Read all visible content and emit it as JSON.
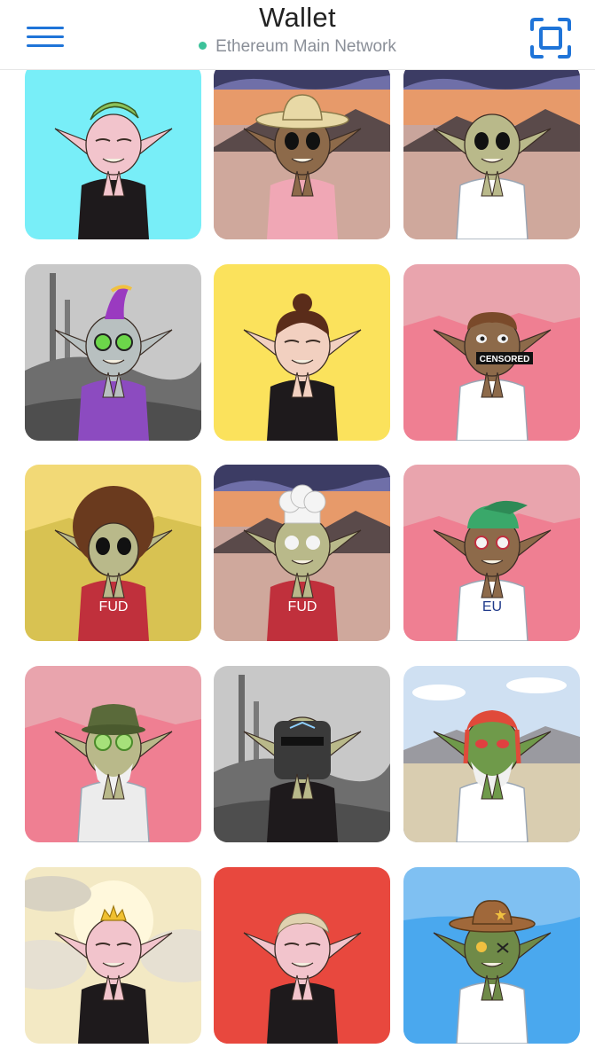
{
  "header": {
    "title": "Wallet",
    "network": "Ethereum Main Network",
    "network_dot_color": "#3cc29a",
    "accent": "#1f74d8",
    "menu_icon": "hamburger-menu-icon",
    "scan_icon": "qr-scan-icon"
  },
  "collectibles": [
    {
      "bg": "#78eef8",
      "scene": "plain",
      "skin": "#f2c4cc",
      "outfit": "#1e1a1c",
      "eyes": "sleepy",
      "hat": "money",
      "shirt_text": ""
    },
    {
      "bg": "#c9a59c",
      "scene": "sunset",
      "skin": "#8d6a4a",
      "outfit": "#f0a7b5",
      "eyes": "black",
      "hat": "straw",
      "shirt_text": ""
    },
    {
      "bg": "#c9a59c",
      "scene": "sunset",
      "skin": "#b9b98a",
      "outfit": "#ffffff",
      "eyes": "black",
      "hat": "none",
      "shirt_text": ""
    },
    {
      "bg": "#b9b9b9",
      "scene": "industrial",
      "skin": "#b8c0c0",
      "outfit": "#8c4bc0",
      "eyes": "goggles",
      "hat": "mohawk",
      "shirt_text": ""
    },
    {
      "bg": "#fbe25c",
      "scene": "plain",
      "skin": "#f2d0c0",
      "outfit": "#1e1a1c",
      "eyes": "sleepy",
      "hat": "bun",
      "shirt_text": ""
    },
    {
      "bg": "#f08d9c",
      "scene": "pinkhills",
      "skin": "#8d6a4a",
      "outfit": "#ffffff",
      "eyes": "censored",
      "hat": "curly",
      "shirt_text": "",
      "censor_text": "CENSORED"
    },
    {
      "bg": "#e3cf5e",
      "scene": "yellowhills",
      "skin": "#b9b98a",
      "outfit": "#c0303c",
      "eyes": "black",
      "hat": "afro",
      "shirt_text": "FUD"
    },
    {
      "bg": "#c9a59c",
      "scene": "sunset",
      "skin": "#b9b98a",
      "outfit": "#c0303c",
      "eyes": "white",
      "hat": "chef",
      "shirt_text": "FUD"
    },
    {
      "bg": "#f08d9c",
      "scene": "pinkhills",
      "skin": "#8d6a4a",
      "outfit": "#ffffff",
      "eyes": "spiral",
      "hat": "cap",
      "shirt_text": "EU"
    },
    {
      "bg": "#f08d9c",
      "scene": "pinkhills",
      "skin": "#b9b98a",
      "outfit": "#ececec",
      "eyes": "cucumber",
      "hat": "bucket",
      "shirt_text": ""
    },
    {
      "bg": "#b9b9b9",
      "scene": "industrial",
      "skin": "#b9b98a",
      "outfit": "#1e1a1c",
      "eyes": "helmet",
      "hat": "none",
      "shirt_text": ""
    },
    {
      "bg": "#d9cfb0",
      "scene": "desert",
      "skin": "#6f9a4a",
      "outfit": "#ffffff",
      "eyes": "red",
      "hat": "dreads",
      "shirt_text": ""
    },
    {
      "bg": "#f4ecc8",
      "scene": "heaven",
      "skin": "#f2c4cc",
      "outfit": "#1e1a1c",
      "eyes": "sleepy",
      "hat": "crown",
      "shirt_text": ""
    },
    {
      "bg": "#e8483e",
      "scene": "plain",
      "skin": "#f2c4cc",
      "outfit": "#1e1a1c",
      "eyes": "sleepy",
      "hat": "hair",
      "shirt_text": ""
    },
    {
      "bg": "#7fc0f2",
      "scene": "bluesky",
      "skin": "#6f8a48",
      "outfit": "#ffffff",
      "eyes": "cowboy",
      "hat": "cowboy",
      "shirt_text": ""
    }
  ]
}
